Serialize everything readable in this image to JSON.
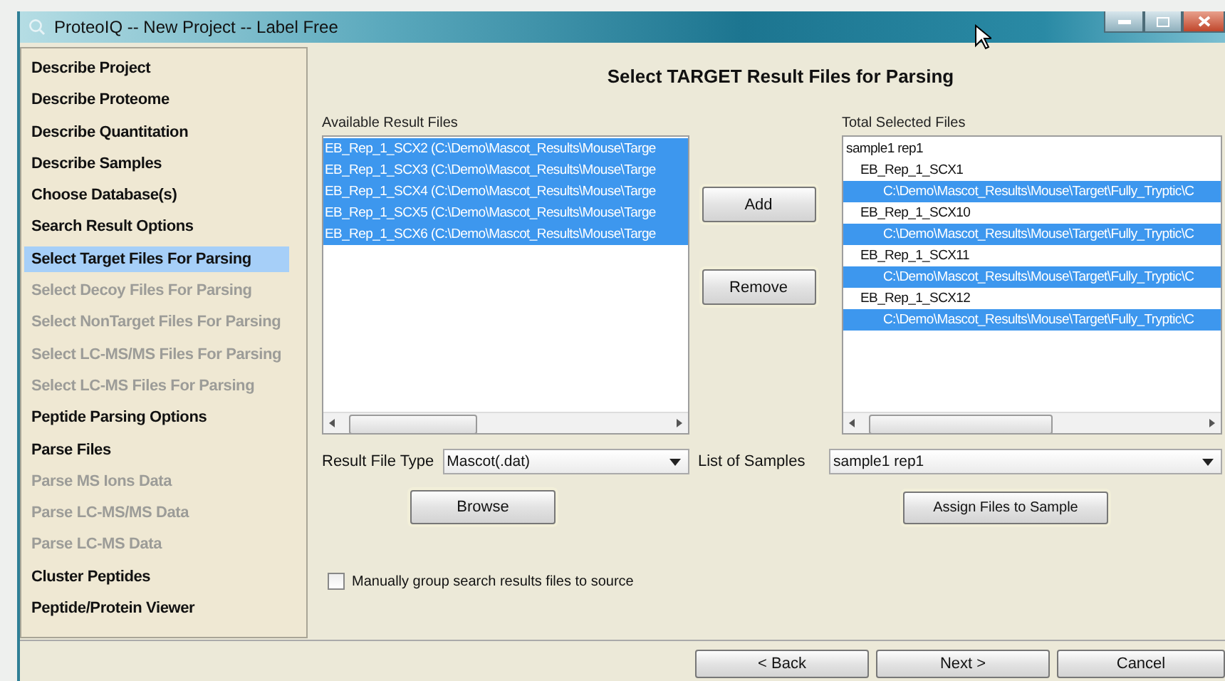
{
  "window": {
    "title": "ProteoIQ -- New Project -- Label Free"
  },
  "sidebar": {
    "items": [
      {
        "label": "Describe Project",
        "selected": false,
        "disabled": false
      },
      {
        "label": "Describe Proteome",
        "selected": false,
        "disabled": false
      },
      {
        "label": "Describe Quantitation",
        "selected": false,
        "disabled": false
      },
      {
        "label": "Describe Samples",
        "selected": false,
        "disabled": false
      },
      {
        "label": "Choose Database(s)",
        "selected": false,
        "disabled": false
      },
      {
        "label": "Search Result Options",
        "selected": false,
        "disabled": false
      },
      {
        "label": "Select Target Files For Parsing",
        "selected": true,
        "disabled": false
      },
      {
        "label": "Select Decoy Files For Parsing",
        "selected": false,
        "disabled": true
      },
      {
        "label": "Select NonTarget Files For Parsing",
        "selected": false,
        "disabled": true
      },
      {
        "label": "Select LC-MS/MS Files For Parsing",
        "selected": false,
        "disabled": true
      },
      {
        "label": "Select LC-MS Files For Parsing",
        "selected": false,
        "disabled": true
      },
      {
        "label": "Peptide Parsing Options",
        "selected": false,
        "disabled": false
      },
      {
        "label": "Parse Files",
        "selected": false,
        "disabled": false
      },
      {
        "label": "Parse MS Ions Data",
        "selected": false,
        "disabled": true
      },
      {
        "label": "Parse LC-MS/MS Data",
        "selected": false,
        "disabled": true
      },
      {
        "label": "Parse LC-MS Data",
        "selected": false,
        "disabled": true
      },
      {
        "label": "Cluster Peptides",
        "selected": false,
        "disabled": false
      },
      {
        "label": "Peptide/Protein Viewer",
        "selected": false,
        "disabled": false
      }
    ]
  },
  "heading": "Select TARGET Result Files for Parsing",
  "available_files": {
    "label": "Available Result Files",
    "items": [
      {
        "text": "EB_Rep_1_SCX2 (C:\\Demo\\Mascot_Results\\Mouse\\Targe",
        "selected": true
      },
      {
        "text": "EB_Rep_1_SCX3 (C:\\Demo\\Mascot_Results\\Mouse\\Targe",
        "selected": true
      },
      {
        "text": "EB_Rep_1_SCX4 (C:\\Demo\\Mascot_Results\\Mouse\\Targe",
        "selected": true
      },
      {
        "text": "EB_Rep_1_SCX5 (C:\\Demo\\Mascot_Results\\Mouse\\Targe",
        "selected": true
      },
      {
        "text": "EB_Rep_1_SCX6 (C:\\Demo\\Mascot_Results\\Mouse\\Targe",
        "selected": true
      }
    ]
  },
  "move_buttons": [
    "Add",
    "Remove"
  ],
  "selected_files": {
    "label": "Total Selected Files",
    "tree": [
      {
        "text": "sample1 rep1",
        "selected": false,
        "children": [
          {
            "text": "EB_Rep_1_SCX1",
            "selected": false,
            "children": [
              {
                "text": "C:\\Demo\\Mascot_Results\\Mouse\\Target\\Fully_Tryptic\\C",
                "selected": true
              }
            ]
          },
          {
            "text": "EB_Rep_1_SCX10",
            "selected": false,
            "children": [
              {
                "text": "C:\\Demo\\Mascot_Results\\Mouse\\Target\\Fully_Tryptic\\C",
                "selected": true
              }
            ]
          },
          {
            "text": "EB_Rep_1_SCX11",
            "selected": false,
            "children": [
              {
                "text": "C:\\Demo\\Mascot_Results\\Mouse\\Target\\Fully_Tryptic\\C",
                "selected": true
              }
            ]
          },
          {
            "text": "EB_Rep_1_SCX12",
            "selected": false,
            "children": [
              {
                "text": "C:\\Demo\\Mascot_Results\\Mouse\\Target\\Fully_Tryptic\\C",
                "selected": true
              }
            ]
          }
        ]
      }
    ]
  },
  "result_file_type": {
    "label": "Result File Type",
    "value": "Mascot(.dat)"
  },
  "list_of_samples": {
    "label": "List of Samples",
    "value": "sample1 rep1"
  },
  "browse_button": "Browse",
  "assign_button": "Assign Files to Sample",
  "manual_group": {
    "label": "Manually group search results files to source",
    "checked": false
  },
  "nav_buttons": [
    "< Back",
    "Next >",
    "Cancel"
  ]
}
